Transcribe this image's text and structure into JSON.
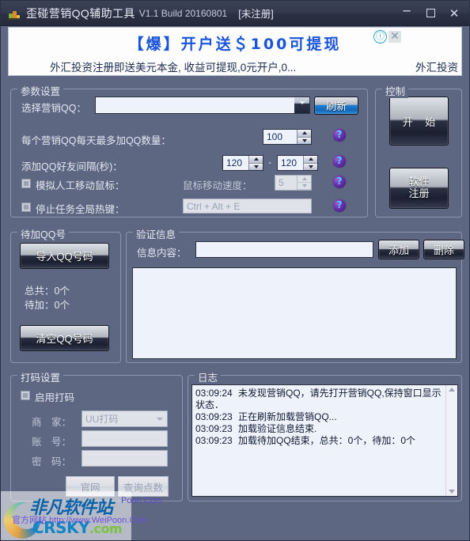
{
  "titlebar": {
    "app_icon": "bar-chart-icon",
    "title": "歪碰营销QQ辅助工具",
    "version": "V1.1 Build 20160801",
    "registration": "[未注册]",
    "minimize": "—",
    "maximize": "maximize-icon",
    "close": "✕"
  },
  "ad": {
    "headline": "【爆】开户送＄100可提现",
    "subline": "外汇投资注册即送美元本金, 收益可提现,0元开户,0...",
    "subline_right": "外汇投资",
    "info_icon": "ⓘ",
    "close_icon": "✕"
  },
  "params": {
    "group_title": "参数设置",
    "select_qq_label": "选择营销QQ：",
    "select_qq_value": "",
    "refresh_button": "刷新",
    "max_per_day_label": "每个营销QQ每天最多加QQ数量：",
    "max_per_day_value": "100",
    "interval_label": "添加QQ好友间隔(秒)：",
    "interval_min": "120",
    "interval_sep": "-",
    "interval_max": "120",
    "simulate_mouse_label": "模拟人工移动鼠标：",
    "simulate_mouse_checked": false,
    "mouse_speed_label": "鼠标移动速度：",
    "mouse_speed_value": "5",
    "hotkey_label": "停止任务全局热键：",
    "hotkey_checked": false,
    "hotkey_value": "Ctrl + Alt + E",
    "help_icon": "?"
  },
  "control": {
    "group_title": "控制",
    "start_button": "开 始",
    "register_button_line1": "软件",
    "register_button_line2": "注册"
  },
  "pending": {
    "group_title": "待加QQ号",
    "import_button": "导入QQ号码",
    "total_label": "总共：0个",
    "pending_label": "待加：0个",
    "clear_button": "清空QQ号码"
  },
  "verify": {
    "group_title": "验证信息",
    "content_label": "信息内容：",
    "content_value": "",
    "add_button": "添加",
    "delete_button": "删除",
    "list_items": []
  },
  "captcha": {
    "group_title": "打码设置",
    "enable_label": "启用打码",
    "enable_checked": false,
    "vendor_label": "商　家：",
    "vendor_value": "UU打码",
    "account_label": "账　号：",
    "account_value": "",
    "password_label": "密　码：",
    "password_value": "",
    "site_button": "官网",
    "query_button": "查询点数"
  },
  "log": {
    "group_title": "日志",
    "entries": [
      {
        "time": "03:09:24",
        "text": "未发现营销QQ，请先打开营销QQ,保持窗口显示状态．"
      },
      {
        "time": "03:09:23",
        "text": "正在刷新加载营销QQ..."
      },
      {
        "time": "03:09:23",
        "text": "加载验证信息结束."
      },
      {
        "time": "03:09:23",
        "text": "加载待加QQ结束，总共：0个，待加：0个"
      }
    ]
  },
  "watermark": {
    "brand_cn": "非凡软件站",
    "brand_en": "CRSKY",
    "brand_en_suffix": ".com",
    "url_overlay": "官方网站 http://www.WeiPoon.Com",
    "url_right": "Poon.Com"
  },
  "colors": {
    "window_bg": "#5d6782",
    "accent_blue": "#1a54d8",
    "panel_bg": "#eef2fa",
    "help_purple": "#6a2fae"
  }
}
